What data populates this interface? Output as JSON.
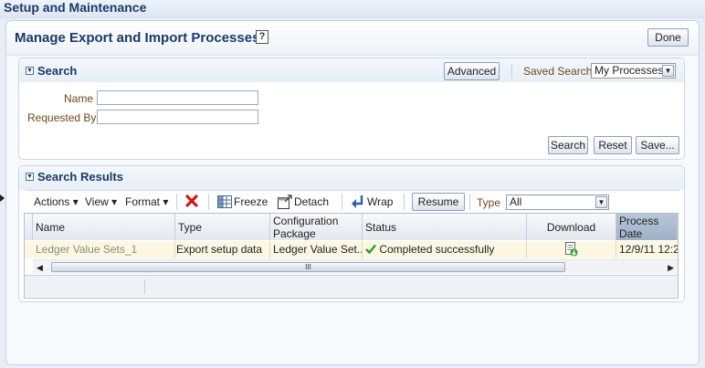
{
  "app": {
    "title": "Setup and Maintenance"
  },
  "page": {
    "title": "Manage Export and Import Processes",
    "help_icon": "?",
    "done_label": "Done"
  },
  "search": {
    "title": "Search",
    "advanced_label": "Advanced",
    "saved_search_label": "Saved Search",
    "saved_search_value": "My Processes",
    "name_label": "Name",
    "name_value": "",
    "requested_by_label": "Requested By",
    "requested_by_value": "",
    "search_label": "Search",
    "reset_label": "Reset",
    "save_label": "Save..."
  },
  "results": {
    "title": "Search Results",
    "toolbar": {
      "actions": "Actions",
      "view": "View",
      "format": "Format",
      "freeze": "Freeze",
      "detach": "Detach",
      "wrap": "Wrap",
      "resume": "Resume",
      "type_label": "Type",
      "type_value": "All"
    },
    "columns": [
      "Name",
      "Type",
      "Configuration Package",
      "Status",
      "Download",
      "Process Date"
    ],
    "rows": [
      {
        "name": "Ledger Value Sets_1",
        "type": "Export setup data",
        "package": "Ledger Value Set...",
        "status": "Completed successfully",
        "date": "12/9/11 12:2"
      }
    ],
    "scroll_grip": "III"
  },
  "colors": {
    "accent": "#1c3a66",
    "selected_row": "#fbf7e2",
    "status_ok": "#2e9b2e",
    "delete": "#cc1a1a"
  },
  "icons": [
    "help-icon",
    "disclose-icon",
    "delete-icon",
    "freeze-icon",
    "detach-icon",
    "wrap-icon",
    "checkmark-icon",
    "download-icon",
    "scroll-left-icon",
    "scroll-right-icon"
  ]
}
